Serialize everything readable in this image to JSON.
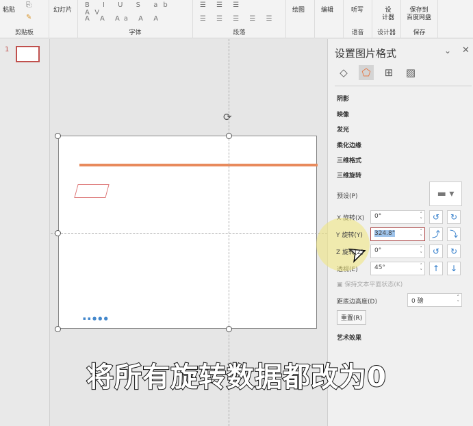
{
  "ribbon": {
    "paste": "粘贴",
    "slides": "幻灯片",
    "draw": "绘图",
    "edit": "编辑",
    "dictate": "听写",
    "designer": "设\n计器",
    "save_baidu": "保存到\n百度网盘",
    "groups": {
      "clipboard": "剪贴板",
      "font": "字体",
      "paragraph": "段落",
      "voice": "语音",
      "designer": "设计器",
      "save": "保存"
    }
  },
  "thumbnails": {
    "slide_number": "1"
  },
  "pane": {
    "title": "设置图片格式",
    "sections": [
      "阴影",
      "映像",
      "发光",
      "柔化边缘",
      "三维格式",
      "三维旋转"
    ],
    "preset_label": "预设(P)",
    "x_label": "X 旋转(X)",
    "x_value": "0°",
    "y_label": "Y 旋转(Y)",
    "y_value": "324.8°",
    "z_label": "Z 旋转(Z)",
    "z_value": "0°",
    "persp_label": "透视(E)",
    "persp_value": "45°",
    "keep_flat": "保持文本平面状态(K)",
    "distance_label": "距底边高度(D)",
    "distance_value": "0 磅",
    "reset": "重置(R)",
    "artistic": "艺术效果"
  },
  "caption": "将所有旋转数据都改为0",
  "colors": {
    "accent": "#c0504d",
    "blue": "#2a78c8"
  }
}
